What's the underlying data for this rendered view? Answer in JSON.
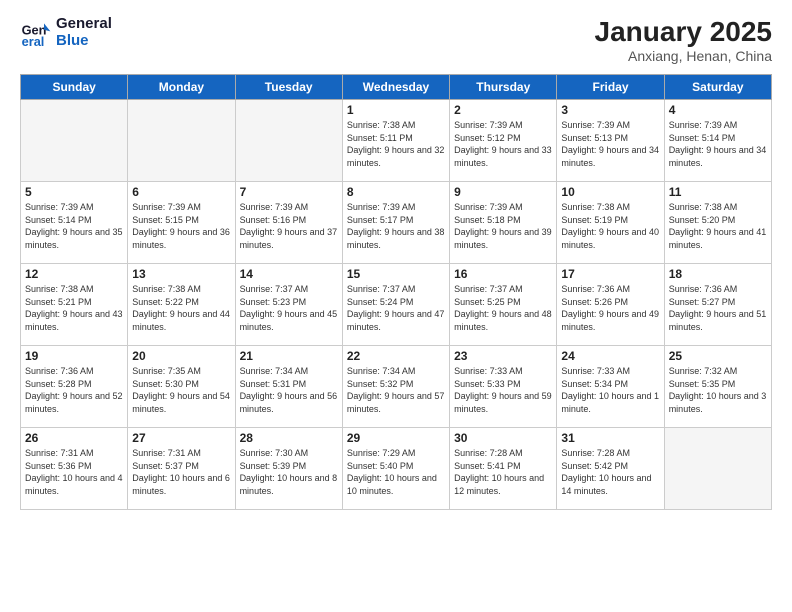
{
  "header": {
    "logo_line1": "General",
    "logo_line2": "Blue",
    "month_title": "January 2025",
    "location": "Anxiang, Henan, China"
  },
  "weekdays": [
    "Sunday",
    "Monday",
    "Tuesday",
    "Wednesday",
    "Thursday",
    "Friday",
    "Saturday"
  ],
  "weeks": [
    [
      {
        "day": "",
        "empty": true
      },
      {
        "day": "",
        "empty": true
      },
      {
        "day": "",
        "empty": true
      },
      {
        "day": "1",
        "sunrise": "7:38 AM",
        "sunset": "5:11 PM",
        "daylight": "9 hours and 32 minutes."
      },
      {
        "day": "2",
        "sunrise": "7:39 AM",
        "sunset": "5:12 PM",
        "daylight": "9 hours and 33 minutes."
      },
      {
        "day": "3",
        "sunrise": "7:39 AM",
        "sunset": "5:13 PM",
        "daylight": "9 hours and 34 minutes."
      },
      {
        "day": "4",
        "sunrise": "7:39 AM",
        "sunset": "5:14 PM",
        "daylight": "9 hours and 34 minutes."
      }
    ],
    [
      {
        "day": "5",
        "sunrise": "7:39 AM",
        "sunset": "5:14 PM",
        "daylight": "9 hours and 35 minutes."
      },
      {
        "day": "6",
        "sunrise": "7:39 AM",
        "sunset": "5:15 PM",
        "daylight": "9 hours and 36 minutes."
      },
      {
        "day": "7",
        "sunrise": "7:39 AM",
        "sunset": "5:16 PM",
        "daylight": "9 hours and 37 minutes."
      },
      {
        "day": "8",
        "sunrise": "7:39 AM",
        "sunset": "5:17 PM",
        "daylight": "9 hours and 38 minutes."
      },
      {
        "day": "9",
        "sunrise": "7:39 AM",
        "sunset": "5:18 PM",
        "daylight": "9 hours and 39 minutes."
      },
      {
        "day": "10",
        "sunrise": "7:38 AM",
        "sunset": "5:19 PM",
        "daylight": "9 hours and 40 minutes."
      },
      {
        "day": "11",
        "sunrise": "7:38 AM",
        "sunset": "5:20 PM",
        "daylight": "9 hours and 41 minutes."
      }
    ],
    [
      {
        "day": "12",
        "sunrise": "7:38 AM",
        "sunset": "5:21 PM",
        "daylight": "9 hours and 43 minutes."
      },
      {
        "day": "13",
        "sunrise": "7:38 AM",
        "sunset": "5:22 PM",
        "daylight": "9 hours and 44 minutes."
      },
      {
        "day": "14",
        "sunrise": "7:37 AM",
        "sunset": "5:23 PM",
        "daylight": "9 hours and 45 minutes."
      },
      {
        "day": "15",
        "sunrise": "7:37 AM",
        "sunset": "5:24 PM",
        "daylight": "9 hours and 47 minutes."
      },
      {
        "day": "16",
        "sunrise": "7:37 AM",
        "sunset": "5:25 PM",
        "daylight": "9 hours and 48 minutes."
      },
      {
        "day": "17",
        "sunrise": "7:36 AM",
        "sunset": "5:26 PM",
        "daylight": "9 hours and 49 minutes."
      },
      {
        "day": "18",
        "sunrise": "7:36 AM",
        "sunset": "5:27 PM",
        "daylight": "9 hours and 51 minutes."
      }
    ],
    [
      {
        "day": "19",
        "sunrise": "7:36 AM",
        "sunset": "5:28 PM",
        "daylight": "9 hours and 52 minutes."
      },
      {
        "day": "20",
        "sunrise": "7:35 AM",
        "sunset": "5:30 PM",
        "daylight": "9 hours and 54 minutes."
      },
      {
        "day": "21",
        "sunrise": "7:34 AM",
        "sunset": "5:31 PM",
        "daylight": "9 hours and 56 minutes."
      },
      {
        "day": "22",
        "sunrise": "7:34 AM",
        "sunset": "5:32 PM",
        "daylight": "9 hours and 57 minutes."
      },
      {
        "day": "23",
        "sunrise": "7:33 AM",
        "sunset": "5:33 PM",
        "daylight": "9 hours and 59 minutes."
      },
      {
        "day": "24",
        "sunrise": "7:33 AM",
        "sunset": "5:34 PM",
        "daylight": "10 hours and 1 minute."
      },
      {
        "day": "25",
        "sunrise": "7:32 AM",
        "sunset": "5:35 PM",
        "daylight": "10 hours and 3 minutes."
      }
    ],
    [
      {
        "day": "26",
        "sunrise": "7:31 AM",
        "sunset": "5:36 PM",
        "daylight": "10 hours and 4 minutes."
      },
      {
        "day": "27",
        "sunrise": "7:31 AM",
        "sunset": "5:37 PM",
        "daylight": "10 hours and 6 minutes."
      },
      {
        "day": "28",
        "sunrise": "7:30 AM",
        "sunset": "5:39 PM",
        "daylight": "10 hours and 8 minutes."
      },
      {
        "day": "29",
        "sunrise": "7:29 AM",
        "sunset": "5:40 PM",
        "daylight": "10 hours and 10 minutes."
      },
      {
        "day": "30",
        "sunrise": "7:28 AM",
        "sunset": "5:41 PM",
        "daylight": "10 hours and 12 minutes."
      },
      {
        "day": "31",
        "sunrise": "7:28 AM",
        "sunset": "5:42 PM",
        "daylight": "10 hours and 14 minutes."
      },
      {
        "day": "",
        "empty": true
      }
    ]
  ]
}
